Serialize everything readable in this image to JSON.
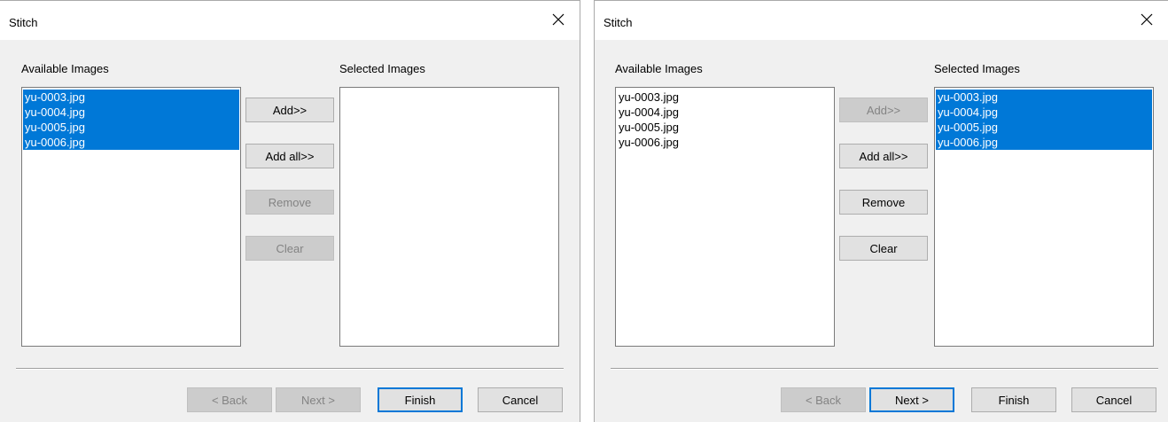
{
  "left": {
    "title": "Stitch",
    "available_label": "Available Images",
    "selected_label": "Selected Images",
    "available_items": [
      "yu-0003.jpg",
      "yu-0004.jpg",
      "yu-0005.jpg",
      "yu-0006.jpg"
    ],
    "selected_items": [],
    "available_selected": true,
    "buttons": {
      "add": {
        "label": "Add>>",
        "enabled": true
      },
      "add_all": {
        "label": "Add all>>",
        "enabled": true
      },
      "remove": {
        "label": "Remove",
        "enabled": false
      },
      "clear": {
        "label": "Clear",
        "enabled": false
      },
      "back": {
        "label": "< Back",
        "enabled": false
      },
      "next": {
        "label": "Next >",
        "enabled": false
      },
      "finish": {
        "label": "Finish",
        "enabled": true,
        "default": true
      },
      "cancel": {
        "label": "Cancel",
        "enabled": true
      }
    }
  },
  "right": {
    "title": "Stitch",
    "available_label": "Available Images",
    "selected_label": "Selected Images",
    "available_items": [
      "yu-0003.jpg",
      "yu-0004.jpg",
      "yu-0005.jpg",
      "yu-0006.jpg"
    ],
    "selected_items": [
      "yu-0003.jpg",
      "yu-0004.jpg",
      "yu-0005.jpg",
      "yu-0006.jpg"
    ],
    "selected_selected": true,
    "buttons": {
      "add": {
        "label": "Add>>",
        "enabled": false
      },
      "add_all": {
        "label": "Add all>>",
        "enabled": true
      },
      "remove": {
        "label": "Remove",
        "enabled": true
      },
      "clear": {
        "label": "Clear",
        "enabled": true
      },
      "back": {
        "label": "< Back",
        "enabled": false
      },
      "next": {
        "label": "Next >",
        "enabled": true,
        "default": true
      },
      "finish": {
        "label": "Finish",
        "enabled": true
      },
      "cancel": {
        "label": "Cancel",
        "enabled": true
      }
    }
  },
  "colors": {
    "selection": "#0078d7",
    "dialog_bg": "#f0f0f0",
    "titlebar_bg": "#ffffff"
  },
  "icons": {
    "close": "close-icon"
  }
}
